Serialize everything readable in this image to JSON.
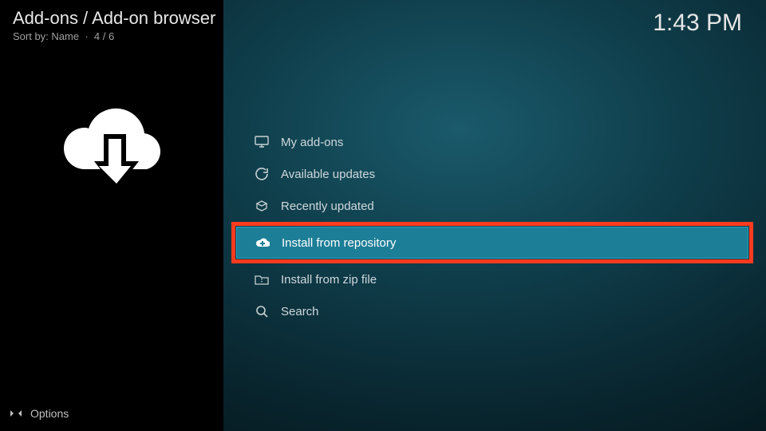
{
  "header": {
    "breadcrumb": "Add-ons / Add-on browser",
    "sort_prefix": "Sort by:",
    "sort_field": "Name",
    "position": "4 / 6"
  },
  "clock": "1:43 PM",
  "sidebar": {
    "options_label": "Options",
    "main_icon": "cloud-download-icon"
  },
  "menu": {
    "items": [
      {
        "icon": "monitor-icon",
        "label": "My add-ons",
        "selected": false
      },
      {
        "icon": "refresh-icon",
        "label": "Available updates",
        "selected": false
      },
      {
        "icon": "openbox-icon",
        "label": "Recently updated",
        "selected": false
      },
      {
        "icon": "cloud-plus-icon",
        "label": "Install from repository",
        "selected": true
      },
      {
        "icon": "folder-zip-icon",
        "label": "Install from zip file",
        "selected": false
      },
      {
        "icon": "search-icon",
        "label": "Search",
        "selected": false
      }
    ]
  }
}
